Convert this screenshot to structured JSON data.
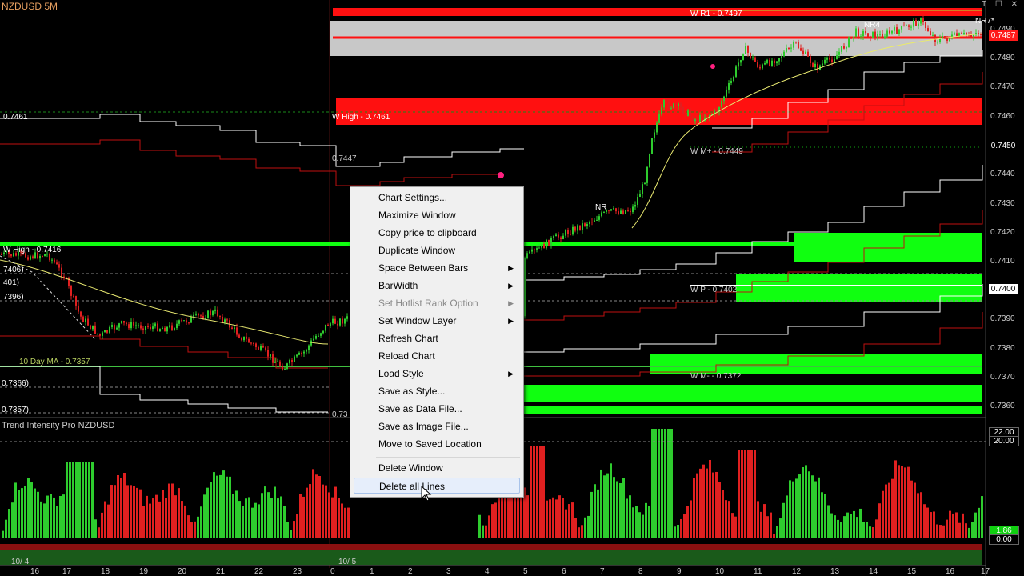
{
  "window": {
    "title": "NZDUSD 5M",
    "controls": "T ☐ ✕"
  },
  "price_axis": {
    "ticks": [
      "0.7490",
      "0.7480",
      "0.7470",
      "0.7460",
      "0.7440",
      "0.7430",
      "0.7420",
      "0.7410",
      "0.7390",
      "0.7380",
      "0.7370",
      "0.7360"
    ],
    "boxes": [
      {
        "value": "0.7487",
        "bg": "#ff1a1a",
        "fg": "#ffffff"
      },
      {
        "value": "0.7450",
        "bg": "#000000",
        "fg": "#ffffff"
      },
      {
        "value": "0.7400",
        "bg": "#ffffff",
        "fg": "#000000"
      }
    ]
  },
  "chart_labels": {
    "wr1": "W R1 - 0.7497",
    "nr7": "NR7*",
    "nr4": "NR4",
    "whigh": "W High - 0.7461",
    "left_7461": "0.7461",
    "level_7447": "0.7447",
    "wm_plus": "W M+ - 0.7449",
    "nr_mid": "NR",
    "whigh2": "W High - 0.7416",
    "l7406": "7406)",
    "l401": "401)",
    "l7396": "7396)",
    "wp": "W P - 0.7402",
    "ma10": "10 Day MA - 0.7357",
    "l7366": "0.7366)",
    "wm_minus": "W M- - 0.7372",
    "l7357": "0.7357)",
    "l073": "0.73"
  },
  "indicator": {
    "title": "Trend Intensity Pro NZDUSD",
    "boxes": [
      "22.00",
      "20.00",
      "1.86",
      "0.00"
    ]
  },
  "time_axis": [
    "16",
    "17",
    "18",
    "19",
    "20",
    "21",
    "22",
    "23",
    "0",
    "1",
    "2",
    "3",
    "4",
    "5",
    "6",
    "7",
    "8",
    "9",
    "10",
    "11",
    "12",
    "13",
    "14",
    "15",
    "16",
    "17"
  ],
  "date_marks": [
    "10/ 4",
    "10/ 5"
  ],
  "context_menu": {
    "items": [
      {
        "label": "Chart Settings...",
        "submenu": false,
        "disabled": false
      },
      {
        "label": "Maximize Window",
        "submenu": false,
        "disabled": false
      },
      {
        "label": "Copy price to clipboard",
        "submenu": false,
        "disabled": false
      },
      {
        "label": "Duplicate Window",
        "submenu": false,
        "disabled": false
      },
      {
        "label": "Space Between Bars",
        "submenu": true,
        "disabled": false
      },
      {
        "label": "BarWidth",
        "submenu": true,
        "disabled": false
      },
      {
        "label": "Set Hotlist Rank Option",
        "submenu": true,
        "disabled": true
      },
      {
        "label": "Set Window Layer",
        "submenu": true,
        "disabled": false
      },
      {
        "label": "Refresh Chart",
        "submenu": false,
        "disabled": false
      },
      {
        "label": "Reload Chart",
        "submenu": false,
        "disabled": false
      },
      {
        "label": "Load Style",
        "submenu": true,
        "disabled": false
      },
      {
        "label": "Save as Style...",
        "submenu": false,
        "disabled": false
      },
      {
        "label": "Save as Data File...",
        "submenu": false,
        "disabled": false
      },
      {
        "label": "Save as  Image File...",
        "submenu": false,
        "disabled": false
      },
      {
        "label": "Move to Saved Location",
        "submenu": false,
        "disabled": false
      },
      {
        "label": "Delete Window",
        "submenu": false,
        "disabled": false
      },
      {
        "label": "Delete all Lines",
        "submenu": false,
        "disabled": false,
        "highlighted": true
      }
    ]
  },
  "colors": {
    "bull": "#2ecc2e",
    "bear": "#e02020",
    "zone_red": "#ff1010",
    "zone_green": "#10ff10",
    "zone_gray": "#c8c8c8",
    "ma": "#e8e870"
  }
}
